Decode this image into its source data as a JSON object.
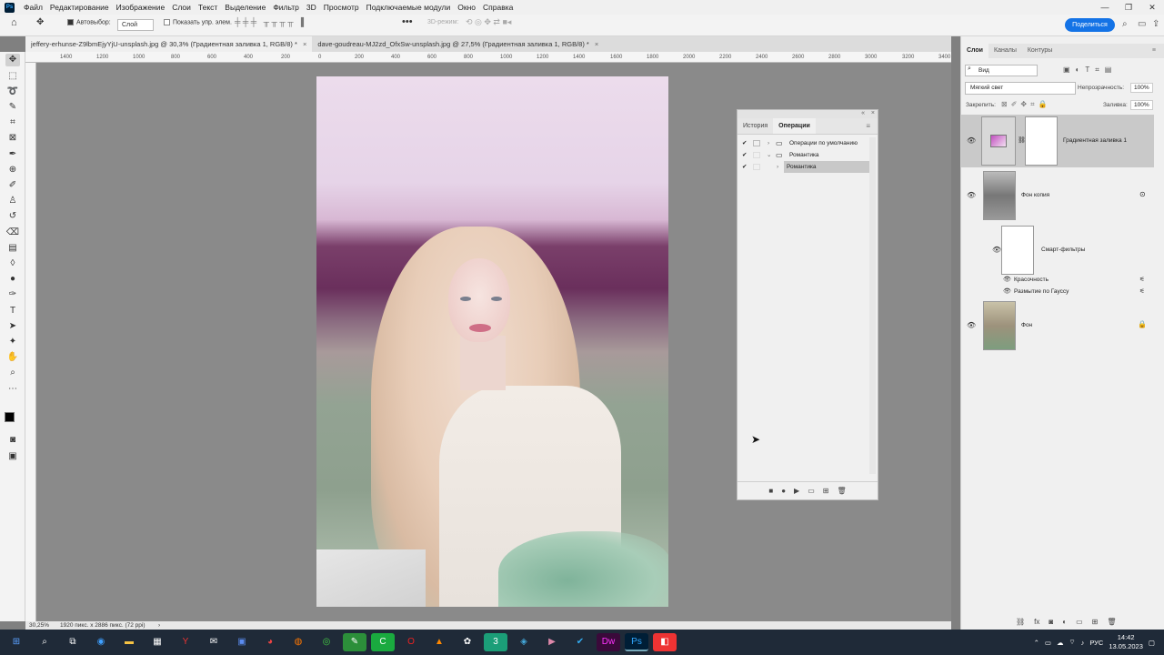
{
  "menubar": {
    "app_icon": "Ps",
    "items": [
      "Файл",
      "Редактирование",
      "Изображение",
      "Слои",
      "Текст",
      "Выделение",
      "Фильтр",
      "3D",
      "Просмотр",
      "Подключаемые модули",
      "Окно",
      "Справка"
    ]
  },
  "options": {
    "autoselect_label": "Автовыбор:",
    "autoselect_value": "Слой",
    "show_transform_label": "Показать упр. элем.",
    "mode3d_label": "3D-режим:",
    "share_label": "Поделиться"
  },
  "tabs": [
    {
      "label": "jeffery-erhunse-Z9lbmEjyYjU-unsplash.jpg @ 30,3% (Градиентная заливка 1, RGB/8) *"
    },
    {
      "label": "dave-goudreau-MJ2zd_OfxSw-unsplash.jpg @ 27,5% (Градиентная заливка 1, RGB/8) *"
    }
  ],
  "ruler": [
    "1400",
    "1200",
    "1000",
    "800",
    "600",
    "400",
    "200",
    "0",
    "200",
    "400",
    "600",
    "800",
    "1000",
    "1200",
    "1400",
    "1600",
    "1800",
    "2000",
    "2200",
    "2400",
    "2600",
    "2800",
    "3000",
    "3200",
    "3400"
  ],
  "operations_panel": {
    "tabs": [
      "История",
      "Операции"
    ],
    "rows": [
      {
        "label": "Операции по умолчанию"
      },
      {
        "label": "Романтика"
      },
      {
        "label": "Романтика"
      }
    ]
  },
  "layers_panel": {
    "tabs": [
      "Слои",
      "Каналы",
      "Контуры"
    ],
    "filter_value": "Вид",
    "blend_mode": "Мягкий свет",
    "opacity_label": "Непрозрачность:",
    "opacity_value": "100%",
    "lock_label": "Закрепить:",
    "fill_label": "Заливка:",
    "fill_value": "100%",
    "layers": [
      {
        "name": "Градиентная заливка 1"
      },
      {
        "name": "Фон копия"
      },
      {
        "name": "Смарт-фильтры"
      },
      {
        "name": "Красочность"
      },
      {
        "name": "Размытие по Гауссу"
      },
      {
        "name": "Фон"
      }
    ]
  },
  "status": {
    "zoom": "30,25%",
    "doc_info": "1920 пикс. x 2886 пикс. (72 ppi)"
  },
  "taskbar": {
    "lang": "РУС",
    "time": "14:42",
    "date": "13.05.2023"
  }
}
